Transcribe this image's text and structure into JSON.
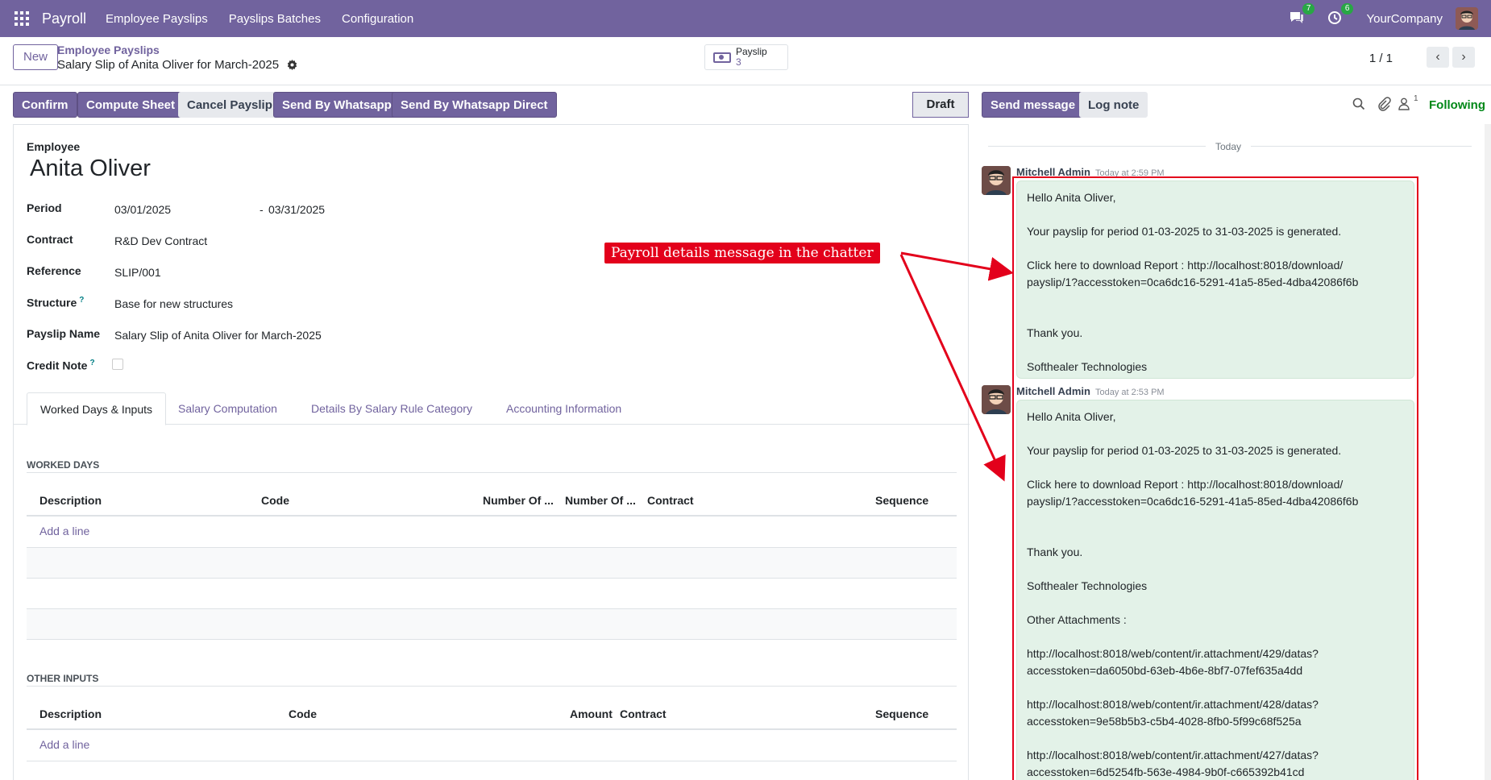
{
  "navbar": {
    "brand": "Payroll",
    "menu": [
      "Employee Payslips",
      "Payslips Batches",
      "Configuration"
    ],
    "messages_count": "7",
    "activities_count": "6",
    "company": "YourCompany"
  },
  "control_panel": {
    "new_label": "New",
    "breadcrumb_parent": "Employee Payslips",
    "breadcrumb_current": "Salary Slip of Anita Oliver for March-2025",
    "smart_button": {
      "label": "Payslip",
      "value": "3"
    },
    "pager": "1 / 1"
  },
  "actions": {
    "confirm": "Confirm",
    "compute_sheet": "Compute Sheet",
    "cancel_payslip": "Cancel Payslip",
    "send_whatsapp": "Send By Whatsapp",
    "send_whatsapp_direct": "Send By Whatsapp Direct",
    "stage": "Draft"
  },
  "form": {
    "employee_label": "Employee",
    "employee_name": "Anita Oliver",
    "period_label": "Period",
    "period_from": "03/01/2025",
    "period_sep": "-",
    "period_to": "03/31/2025",
    "contract_label": "Contract",
    "contract": "R&D Dev Contract",
    "reference_label": "Reference",
    "reference": "SLIP/001",
    "structure_label": "Structure",
    "structure": "Base for new structures",
    "payslip_name_label": "Payslip Name",
    "payslip_name": "Salary Slip of Anita Oliver for March-2025",
    "credit_note_label": "Credit Note",
    "help_mark": "?"
  },
  "tabs": [
    "Worked Days & Inputs",
    "Salary Computation",
    "Details By Salary Rule Category",
    "Accounting Information"
  ],
  "worked_days": {
    "title": "WORKED DAYS",
    "columns": [
      "Description",
      "Code",
      "Number Of ...",
      "Number Of ...",
      "Contract",
      "Sequence"
    ],
    "add_line": "Add a line"
  },
  "other_inputs": {
    "title": "OTHER INPUTS",
    "columns": [
      "Description",
      "Code",
      "Amount",
      "Contract",
      "Sequence"
    ],
    "add_line": "Add a line"
  },
  "chatter": {
    "send_message": "Send message",
    "log_note": "Log note",
    "followers_count": "1",
    "following": "Following",
    "date_separator": "Today",
    "messages": [
      {
        "author": "Mitchell Admin",
        "time": "Today at 2:59 PM",
        "lines": [
          "Hello Anita Oliver,",
          "Your payslip for period 01-03-2025 to 31-03-2025 is generated.",
          "Click here to download Report : http://localhost:8018/download/",
          "payslip/1?accesstoken=0ca6dc16-5291-41a5-85ed-4dba42086f6b",
          "Thank you.",
          "Softhealer Technologies"
        ]
      },
      {
        "author": "Mitchell Admin",
        "time": "Today at 2:53 PM",
        "lines": [
          "Hello Anita Oliver,",
          "Your payslip for period 01-03-2025 to 31-03-2025 is generated.",
          "Click here to download Report : http://localhost:8018/download/",
          "payslip/1?accesstoken=0ca6dc16-5291-41a5-85ed-4dba42086f6b",
          "Thank you.",
          "Softhealer Technologies",
          "Other Attachments :",
          "http://localhost:8018/web/content/ir.attachment/429/datas?",
          "accesstoken=da6050bd-63eb-4b6e-8bf7-07fef635a4dd",
          "http://localhost:8018/web/content/ir.attachment/428/datas?",
          "accesstoken=9e58b5b3-c5b4-4028-8fb0-5f99c68f525a",
          "http://localhost:8018/web/content/ir.attachment/427/datas?",
          "accesstoken=6d5254fb-563e-4984-9b0f-c665392b41cd"
        ]
      }
    ]
  },
  "annotation": "Payroll details message in the chatter",
  "colors": {
    "primary": "#71639e",
    "annotation": "#e3001b",
    "message_bg": "#e3f2e8",
    "following": "#008818"
  }
}
